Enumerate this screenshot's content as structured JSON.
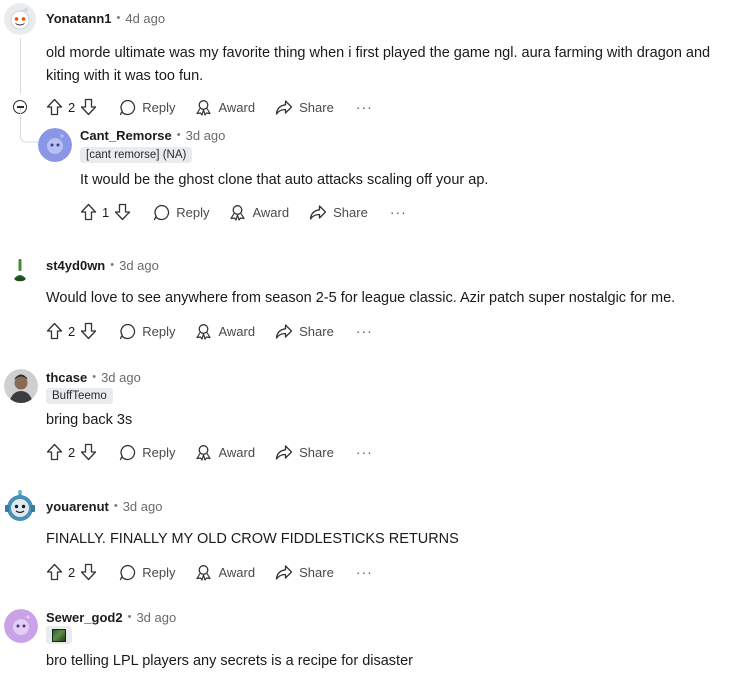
{
  "actions": {
    "reply": "Reply",
    "award": "Award",
    "share": "Share",
    "more": "···"
  },
  "comments": [
    {
      "username": "Yonatann1",
      "time": "4d ago",
      "text": "old morde ultimate was my favorite thing when i first played the game ngl. aura farming with dragon and kiting with it was too fun.",
      "votes": "2"
    },
    {
      "username": "Cant_Remorse",
      "time": "3d ago",
      "flair": "[cant remorse] (NA)",
      "text": "It would be the ghost clone that auto attacks scaling off your ap.",
      "votes": "1"
    },
    {
      "username": "st4yd0wn",
      "time": "3d ago",
      "text": "Would love to see anywhere from season 2-5 for league classic. Azir patch super nostalgic for me.",
      "votes": "2"
    },
    {
      "username": "thcase",
      "time": "3d ago",
      "flair": "BuffTeemo",
      "text": "bring back 3s",
      "votes": "2"
    },
    {
      "username": "youarenut",
      "time": "3d ago",
      "text": "FINALLY. FINALLY MY OLD CROW FIDDLESTICKS RETURNS",
      "votes": "2"
    },
    {
      "username": "Sewer_god2",
      "time": "3d ago",
      "text": "bro telling LPL players any secrets is a recipe for disaster"
    }
  ],
  "colors": {
    "text": "#1a1a1b",
    "muted": "#6b6b6b",
    "flair_bg": "#e9ecee",
    "thread_line": "#d7dadc"
  },
  "icons": {
    "upvote": "arrow-up-icon",
    "downvote": "arrow-down-icon",
    "reply": "speech-bubble-icon",
    "award": "award-icon",
    "share": "share-arrow-icon",
    "collapse": "minus-circle-icon"
  }
}
